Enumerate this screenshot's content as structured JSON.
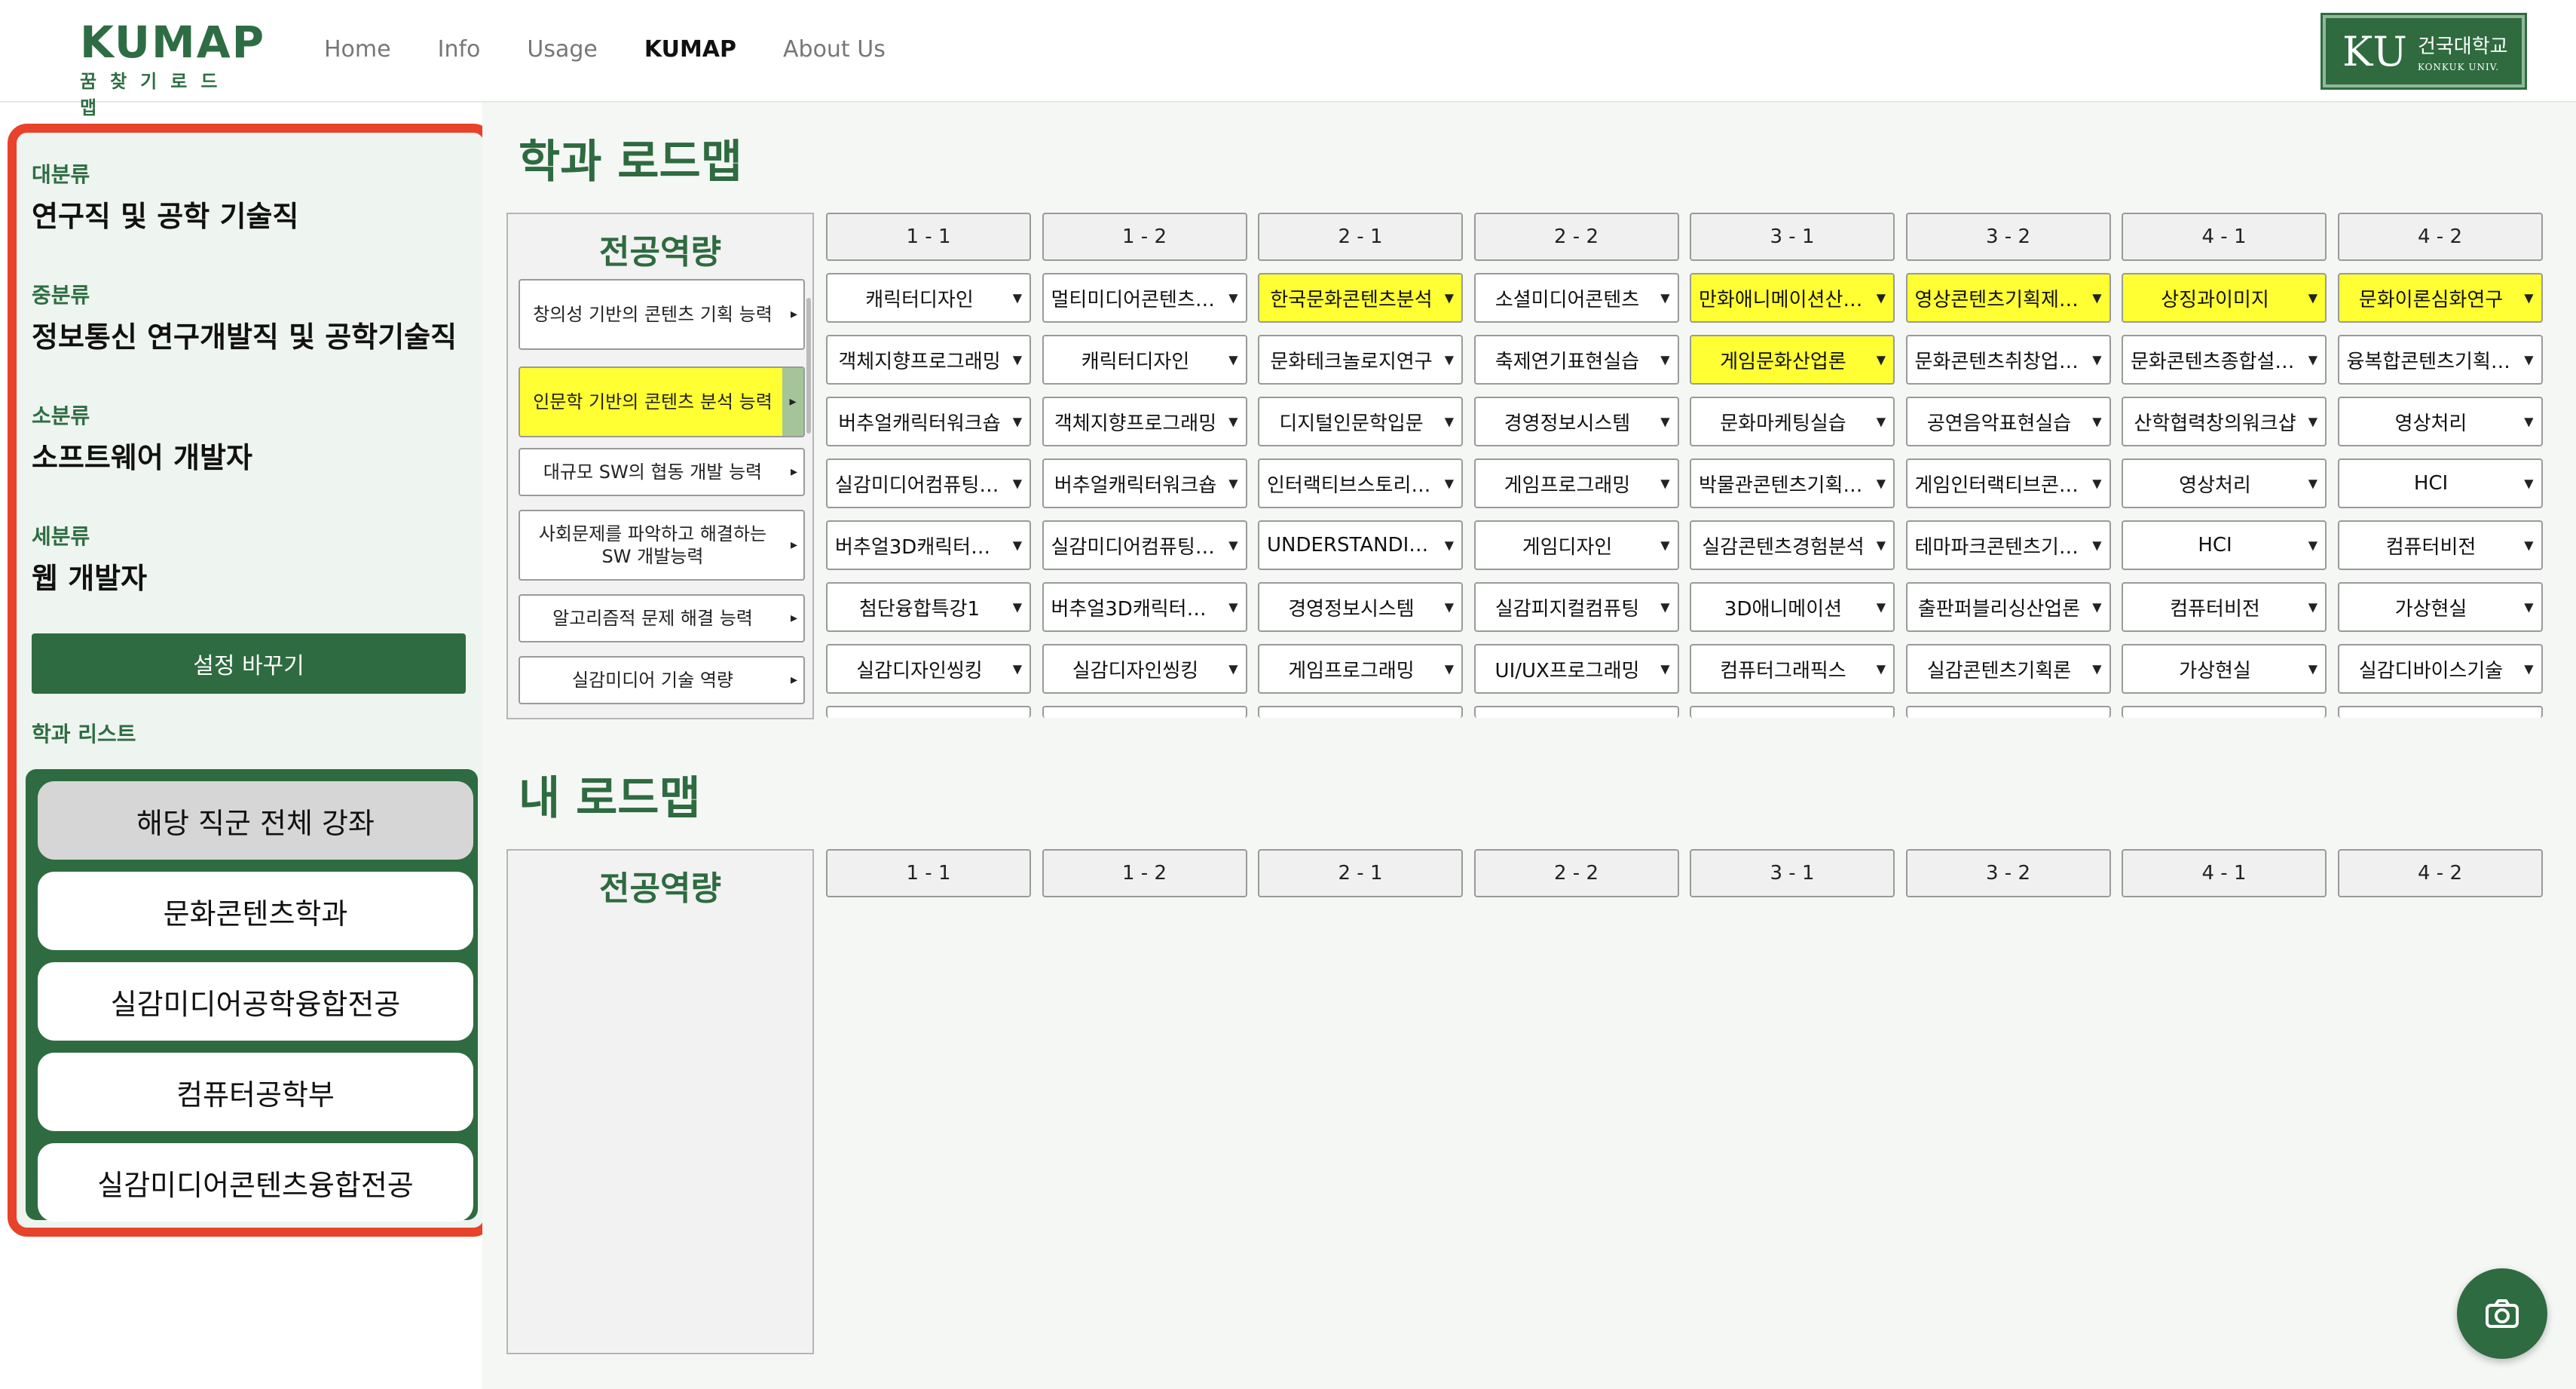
{
  "header": {
    "logo": "KUMAP",
    "logo_sub": "꿈찾기로드맵",
    "nav": [
      "Home",
      "Info",
      "Usage",
      "KUMAP",
      "About Us"
    ],
    "nav_active": "KUMAP",
    "badge_ku": "KU",
    "badge_kor": "건국대학교",
    "badge_eng": "KONKUK UNIV."
  },
  "sidebar": {
    "major_label": "대분류",
    "major_value": "연구직 및 공학 기술직",
    "mid_label": "중분류",
    "mid_value": "정보통신 연구개발직 및 공학기술직",
    "minor_label": "소분류",
    "minor_value": "소프트웨어 개발자",
    "detail_label": "세분류",
    "detail_value": "웹 개발자",
    "change_button": "설정 바꾸기",
    "dept_list_label": "학과 리스트",
    "departments": [
      "해당 직군 전체 강좌",
      "문화콘텐츠학과",
      "실감미디어공학융합전공",
      "컴퓨터공학부",
      "실감미디어콘텐츠융합전공"
    ]
  },
  "dept_roadmap": {
    "title": "학과 로드맵",
    "capability_title": "전공역량",
    "capabilities": [
      {
        "label": "창의성 기반의 콘텐츠 기획 능력",
        "highlighted": false
      },
      {
        "label": "인문학 기반의 콘텐츠 분석 능력",
        "highlighted": true
      },
      {
        "label": "대규모 SW의 협동 개발 능력",
        "highlighted": false
      },
      {
        "label": "사회문제를 파악하고 해결하는 SW 개발능력",
        "highlighted": false
      },
      {
        "label": "알고리즘적 문제 해결 능력",
        "highlighted": false
      },
      {
        "label": "실감미디어 기술 역량",
        "highlighted": false
      }
    ],
    "semesters": [
      "1 - 1",
      "1 - 2",
      "2 - 1",
      "2 - 2",
      "3 - 1",
      "3 - 2",
      "4 - 1",
      "4 - 2"
    ],
    "columns": [
      [
        {
          "t": "캐릭터디자인",
          "h": false
        },
        {
          "t": "객체지향프로그래밍",
          "h": false
        },
        {
          "t": "버추얼캐릭터워크숍",
          "h": false
        },
        {
          "t": "실감미디어컴퓨팅기초",
          "h": false
        },
        {
          "t": "버추얼3D캐릭터모…",
          "h": false
        },
        {
          "t": "첨단융합특강1",
          "h": false
        },
        {
          "t": "실감디자인씽킹",
          "h": false
        }
      ],
      [
        {
          "t": "멀티미디어콘텐츠실습",
          "h": false
        },
        {
          "t": "캐릭터디자인",
          "h": false
        },
        {
          "t": "객체지향프로그래밍",
          "h": false
        },
        {
          "t": "버추얼캐릭터워크숍",
          "h": false
        },
        {
          "t": "실감미디어컴퓨팅기초",
          "h": false
        },
        {
          "t": "버추얼3D캐릭터모…",
          "h": false
        },
        {
          "t": "실감디자인씽킹",
          "h": false
        }
      ],
      [
        {
          "t": "한국문화콘텐츠분석",
          "h": true
        },
        {
          "t": "문화테크놀로지연구",
          "h": false
        },
        {
          "t": "디지털인문학입문",
          "h": false
        },
        {
          "t": "인터랙티브스토리텔링",
          "h": false
        },
        {
          "t": "UNDERSTANDING …",
          "h": false
        },
        {
          "t": "경영정보시스템",
          "h": false
        },
        {
          "t": "게임프로그래밍",
          "h": false
        }
      ],
      [
        {
          "t": "소셜미디어콘텐츠",
          "h": false
        },
        {
          "t": "축제연기표현실습",
          "h": false
        },
        {
          "t": "경영정보시스템",
          "h": false
        },
        {
          "t": "게임프로그래밍",
          "h": false
        },
        {
          "t": "게임디자인",
          "h": false
        },
        {
          "t": "실감피지컬컴퓨팅",
          "h": false
        },
        {
          "t": "UI/UX프로그래밍",
          "h": false
        }
      ],
      [
        {
          "t": "만화애니메이션산업론",
          "h": true
        },
        {
          "t": "게임문화산업론",
          "h": true
        },
        {
          "t": "문화마케팅실습",
          "h": false
        },
        {
          "t": "박물관콘텐츠기획실습",
          "h": false
        },
        {
          "t": "실감콘텐츠경험분석",
          "h": false
        },
        {
          "t": "3D애니메이션",
          "h": false
        },
        {
          "t": "컴퓨터그래픽스",
          "h": false
        }
      ],
      [
        {
          "t": "영상콘텐츠기획제작…",
          "h": true
        },
        {
          "t": "문화콘텐츠취창업실습",
          "h": false
        },
        {
          "t": "공연음악표현실습",
          "h": false
        },
        {
          "t": "게임인터랙티브콘텐…",
          "h": false
        },
        {
          "t": "테마파크콘텐츠기획…",
          "h": false
        },
        {
          "t": "출판퍼블리싱산업론",
          "h": false
        },
        {
          "t": "실감콘텐츠기획론",
          "h": false
        }
      ],
      [
        {
          "t": "상징과이미지",
          "h": true
        },
        {
          "t": "문화콘텐츠종합설계…",
          "h": false
        },
        {
          "t": "산학협력창의워크샵",
          "h": false
        },
        {
          "t": "영상처리",
          "h": false
        },
        {
          "t": "HCI",
          "h": false
        },
        {
          "t": "컴퓨터비전",
          "h": false
        },
        {
          "t": "가상현실",
          "h": false
        }
      ],
      [
        {
          "t": "문화이론심화연구",
          "h": true
        },
        {
          "t": "융복합콘텐츠기획실습",
          "h": false
        },
        {
          "t": "영상처리",
          "h": false
        },
        {
          "t": "HCI",
          "h": false
        },
        {
          "t": "컴퓨터비전",
          "h": false
        },
        {
          "t": "가상현실",
          "h": false
        },
        {
          "t": "실감디바이스기술",
          "h": false
        }
      ]
    ]
  },
  "my_roadmap": {
    "title": "내 로드맵",
    "capability_title": "전공역량",
    "semesters": [
      "1 - 1",
      "1 - 2",
      "2 - 1",
      "2 - 2",
      "3 - 1",
      "3 - 2",
      "4 - 1",
      "4 - 2"
    ]
  },
  "icons": {
    "camera": "camera-icon",
    "dropdown": "caret-down-icon",
    "expand": "chevron-right-icon"
  },
  "colors": {
    "brand_green": "#2e6b40",
    "highlight_yellow": "#ffff33",
    "panel_border_red": "#e8422a"
  }
}
